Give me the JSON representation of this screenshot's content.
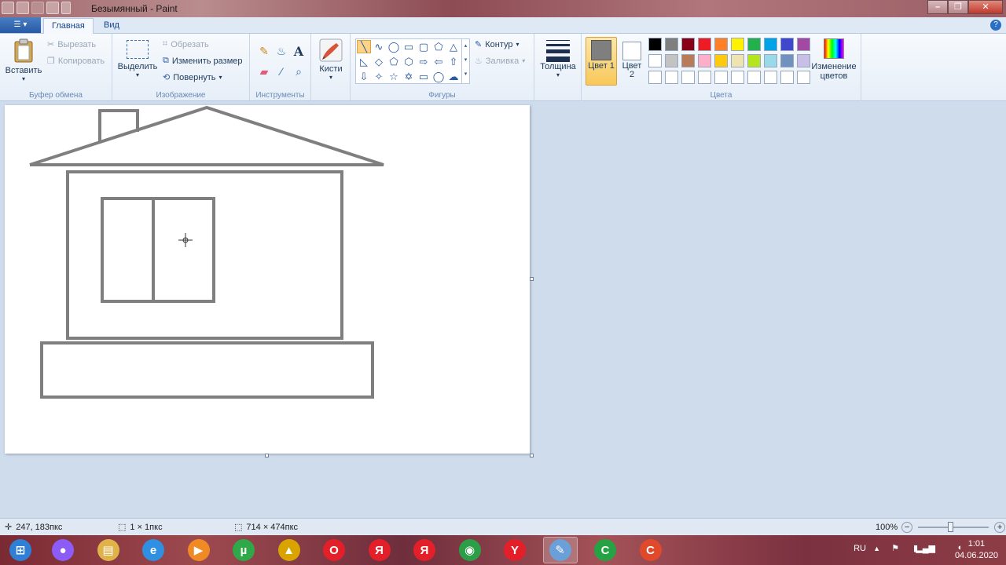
{
  "window": {
    "title": "Безымянный - Paint",
    "controls": {
      "minimize": "–",
      "maximize": "❐",
      "close": "✕"
    }
  },
  "tabs": {
    "file_menu_icon": "paint-menu-icon",
    "items": [
      "Главная",
      "Вид"
    ],
    "help": "?"
  },
  "ribbon": {
    "clipboard": {
      "label": "Буфер обмена",
      "paste": "Вставить",
      "cut": "Вырезать",
      "copy": "Копировать"
    },
    "image": {
      "label": "Изображение",
      "select": "Выделить",
      "crop": "Обрезать",
      "resize": "Изменить размер",
      "rotate": "Повернуть"
    },
    "tools": {
      "label": "Инструменты",
      "text_tool": "A"
    },
    "brushes": "Кисти",
    "shapes": {
      "label": "Фигуры",
      "outline": "Контур",
      "fill": "Заливка"
    },
    "size": "Толщина",
    "colors": {
      "label": "Цвета",
      "color1": "Цвет 1",
      "color2": "Цвет 2",
      "edit_colors": "Изменение цветов",
      "color1_value": "#7f7f7f",
      "color2_value": "#ffffff",
      "palette_row1": [
        "#000000",
        "#7f7f7f",
        "#880015",
        "#ed1c24",
        "#ff7f27",
        "#fff200",
        "#22b14c",
        "#00a2e8",
        "#3f48cc",
        "#a349a4"
      ],
      "palette_row2": [
        "#ffffff",
        "#c3c3c3",
        "#b97a57",
        "#ffaec9",
        "#ffc90e",
        "#efe4b0",
        "#b5e61d",
        "#99d9ea",
        "#7092be",
        "#c8bfe7"
      ],
      "palette_row3": [
        "#ffffff",
        "#ffffff",
        "#ffffff",
        "#ffffff",
        "#ffffff",
        "#ffffff",
        "#ffffff",
        "#ffffff",
        "#ffffff",
        "#ffffff"
      ]
    }
  },
  "status": {
    "cursor_pos": "247, 183пкс",
    "selection_size": "1 × 1пкс",
    "image_size": "714 × 474пкс",
    "zoom": "100%",
    "zoom_out": "−",
    "zoom_in": "+"
  },
  "taskbar": {
    "items": [
      {
        "name": "start-button",
        "glyph": "⊞",
        "color": "#2f7fd6"
      },
      {
        "name": "alice-app",
        "glyph": "●",
        "color": "#8b5cf6"
      },
      {
        "name": "file-explorer",
        "glyph": "▤",
        "color": "#e0b34a"
      },
      {
        "name": "internet-explorer",
        "glyph": "e",
        "color": "#2f8fe0"
      },
      {
        "name": "media-player",
        "glyph": "▶",
        "color": "#f08a24"
      },
      {
        "name": "utorrent",
        "glyph": "µ",
        "color": "#2fa84a"
      },
      {
        "name": "app-triangle",
        "glyph": "▲",
        "color": "#d9a400"
      },
      {
        "name": "opera",
        "glyph": "O",
        "color": "#e3202a"
      },
      {
        "name": "yandex-app-1",
        "glyph": "Я",
        "color": "#e3202a"
      },
      {
        "name": "yandex-app-2",
        "glyph": "Я",
        "color": "#e3202a"
      },
      {
        "name": "chrome",
        "glyph": "◉",
        "color": "#2d9e48"
      },
      {
        "name": "yandex-browser",
        "glyph": "Y",
        "color": "#e3202a"
      },
      {
        "name": "paint",
        "glyph": "✎",
        "color": "#6a9fd8"
      },
      {
        "name": "camtasia-green",
        "glyph": "C",
        "color": "#25a244"
      },
      {
        "name": "camtasia-red",
        "glyph": "C",
        "color": "#e04a2b"
      }
    ],
    "language": "RU",
    "time": "1:01",
    "date": "04.06.2020"
  }
}
